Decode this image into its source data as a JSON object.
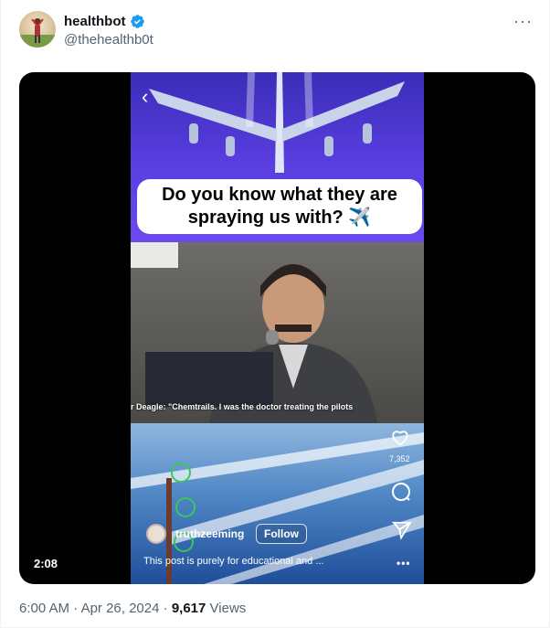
{
  "author": {
    "name": "healthbot",
    "handle": "@thehealthb0t",
    "verified": true,
    "verified_color": "#1d9bf0"
  },
  "header": {
    "more_icon": "more-horizontal-icon"
  },
  "media": {
    "duration": "2:08",
    "top_caption": "Do you know what they are spraying us with? ✈️",
    "subtitle": "r Deagle: \"Chemtrails. I was the doctor treating the pilots",
    "instagram": {
      "username": "truthzeeming",
      "follow_label": "Follow",
      "caption": "This post is purely for educational and ...",
      "likes": "7,352",
      "icons": [
        "heart-icon",
        "comment-icon",
        "share-icon",
        "more-icon"
      ]
    }
  },
  "footer": {
    "time": "6:00 AM",
    "separator": "·",
    "date": "Apr 26, 2024",
    "views_count": "9,617",
    "views_label": "Views"
  }
}
